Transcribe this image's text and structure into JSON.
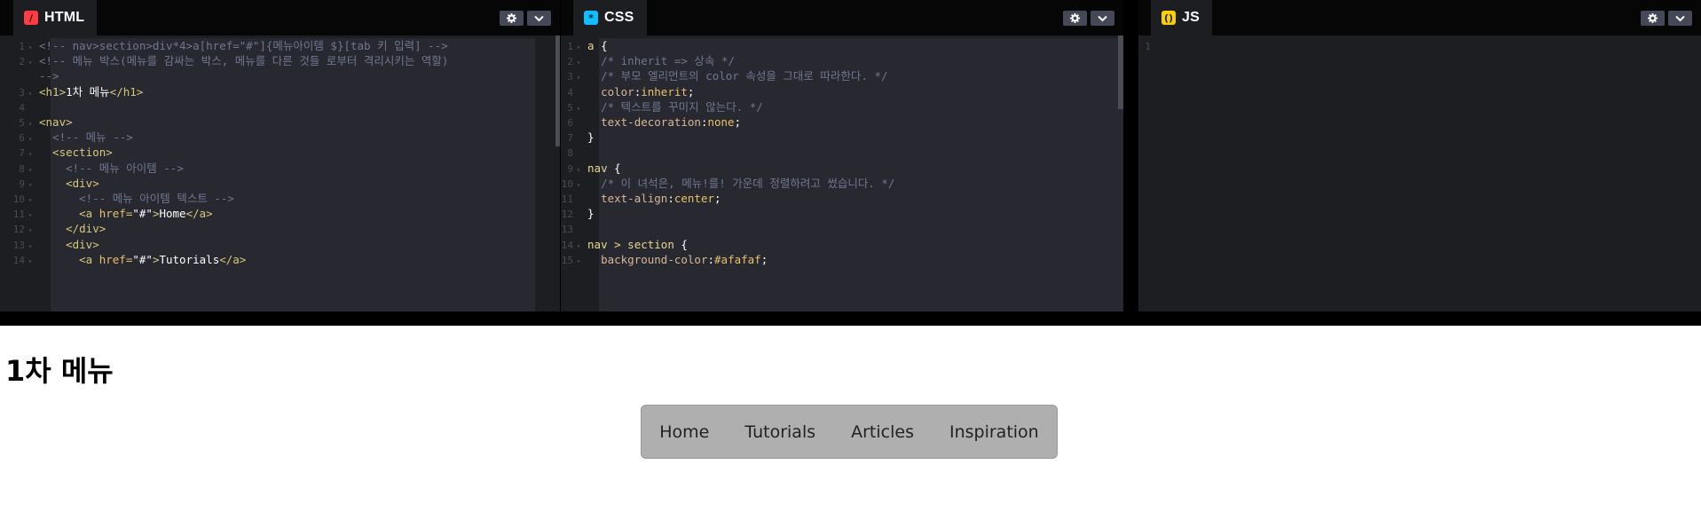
{
  "editors": {
    "html": {
      "tab_label": "HTML",
      "icon": "html-icon",
      "lines": [
        {
          "n": "1",
          "fold": true,
          "segs": [
            [
              "c-com",
              "<!-- nav>section>div*4>a[href=\"#\"]{메뉴아이템 $}[tab 키 입력] -->"
            ]
          ]
        },
        {
          "n": "2",
          "fold": true,
          "segs": [
            [
              "c-com",
              "<!-- 메뉴 박스(메뉴를 감싸는 박스, 메뉴를 다른 것들 로부터 격리시키는 역할)"
            ]
          ]
        },
        {
          "n": "",
          "fold": false,
          "segs": [
            [
              "c-com",
              "-->"
            ]
          ]
        },
        {
          "n": "3",
          "fold": true,
          "segs": [
            [
              "c-tag",
              "<h1>"
            ],
            [
              "c-txt",
              "1차 메뉴"
            ],
            [
              "c-tag",
              "</h1>"
            ]
          ]
        },
        {
          "n": "4",
          "fold": false,
          "segs": []
        },
        {
          "n": "5",
          "fold": true,
          "segs": [
            [
              "c-tag",
              "<nav>"
            ]
          ]
        },
        {
          "n": "6",
          "fold": true,
          "segs": [
            [
              "c-com",
              "  <!-- 메뉴 -->"
            ]
          ]
        },
        {
          "n": "7",
          "fold": true,
          "segs": [
            [
              "c-tag",
              "  <section>"
            ]
          ]
        },
        {
          "n": "8",
          "fold": true,
          "segs": [
            [
              "c-com",
              "    <!-- 메뉴 아이템 -->"
            ]
          ]
        },
        {
          "n": "9",
          "fold": true,
          "segs": [
            [
              "c-tag",
              "    <div>"
            ]
          ]
        },
        {
          "n": "10",
          "fold": true,
          "segs": [
            [
              "c-com",
              "      <!-- 메뉴 아이템 텍스트 -->"
            ]
          ]
        },
        {
          "n": "11",
          "fold": true,
          "segs": [
            [
              "c-tag",
              "      <a "
            ],
            [
              "c-attr",
              "href="
            ],
            [
              "c-str",
              "\"#\""
            ],
            [
              "c-tag",
              ">"
            ],
            [
              "c-txt",
              "Home"
            ],
            [
              "c-tag",
              "</a>"
            ]
          ]
        },
        {
          "n": "12",
          "fold": true,
          "segs": [
            [
              "c-tag",
              "    </div>"
            ]
          ]
        },
        {
          "n": "13",
          "fold": true,
          "segs": [
            [
              "c-tag",
              "    <div>"
            ]
          ]
        },
        {
          "n": "14",
          "fold": true,
          "segs": [
            [
              "c-tag",
              "      <a "
            ],
            [
              "c-attr",
              "href="
            ],
            [
              "c-str",
              "\"#\""
            ],
            [
              "c-tag",
              ">"
            ],
            [
              "c-txt",
              "Tutorials"
            ],
            [
              "c-tag",
              "</a>"
            ]
          ]
        }
      ]
    },
    "css": {
      "tab_label": "CSS",
      "icon": "css-icon",
      "lines": [
        {
          "n": "1",
          "fold": true,
          "segs": [
            [
              "c-sel",
              "a"
            ],
            [
              "c-pun",
              " {"
            ]
          ]
        },
        {
          "n": "2",
          "fold": true,
          "segs": [
            [
              "c-com",
              "  /* inherit => 상속 */"
            ]
          ]
        },
        {
          "n": "3",
          "fold": true,
          "segs": [
            [
              "c-com",
              "  /* 부모 엘리먼트의 color 속성을 그대로 따라한다. */"
            ]
          ]
        },
        {
          "n": "4",
          "fold": false,
          "segs": [
            [
              "c-prop",
              "  color"
            ],
            [
              "c-pun",
              ":"
            ],
            [
              "c-val",
              "inherit"
            ],
            [
              "c-pun",
              ";"
            ]
          ]
        },
        {
          "n": "5",
          "fold": true,
          "segs": [
            [
              "c-com",
              "  /* 텍스트를 꾸미지 않는다. */"
            ]
          ]
        },
        {
          "n": "6",
          "fold": false,
          "segs": [
            [
              "c-prop",
              "  text-decoration"
            ],
            [
              "c-pun",
              ":"
            ],
            [
              "c-val",
              "none"
            ],
            [
              "c-pun",
              ";"
            ]
          ]
        },
        {
          "n": "7",
          "fold": false,
          "segs": [
            [
              "c-pun",
              "}"
            ]
          ]
        },
        {
          "n": "8",
          "fold": false,
          "segs": []
        },
        {
          "n": "9",
          "fold": true,
          "segs": [
            [
              "c-sel",
              "nav"
            ],
            [
              "c-pun",
              " {"
            ]
          ]
        },
        {
          "n": "10",
          "fold": true,
          "segs": [
            [
              "c-com",
              "  /* 이 녀석은, 메뉴!를! 가운데 정렬하려고 썼습니다. */"
            ]
          ]
        },
        {
          "n": "11",
          "fold": false,
          "segs": [
            [
              "c-prop",
              "  text-align"
            ],
            [
              "c-pun",
              ":"
            ],
            [
              "c-val",
              "center"
            ],
            [
              "c-pun",
              ";"
            ]
          ]
        },
        {
          "n": "12",
          "fold": false,
          "segs": [
            [
              "c-pun",
              "}"
            ]
          ]
        },
        {
          "n": "13",
          "fold": false,
          "segs": []
        },
        {
          "n": "14",
          "fold": true,
          "segs": [
            [
              "c-sel",
              "nav > section"
            ],
            [
              "c-pun",
              " {"
            ]
          ]
        },
        {
          "n": "15",
          "fold": true,
          "segs": [
            [
              "c-prop",
              "  background-color"
            ],
            [
              "c-pun",
              ":"
            ],
            [
              "c-hex",
              "#afafaf"
            ],
            [
              "c-pun",
              ";"
            ]
          ]
        }
      ]
    },
    "js": {
      "tab_label": "JS",
      "icon": "js-icon",
      "lines": [
        {
          "n": "1",
          "fold": false,
          "segs": []
        }
      ]
    }
  },
  "preview": {
    "title": "1차 메뉴",
    "menu_items": [
      "Home",
      "Tutorials",
      "Articles",
      "Inspiration"
    ]
  },
  "colors": {
    "editor_bg": "#1d1e22",
    "header_bg": "#060606",
    "html_accent": "#ff3c41",
    "css_accent": "#0ebeff",
    "js_accent": "#fcd000",
    "menu_bg": "#afafaf"
  }
}
